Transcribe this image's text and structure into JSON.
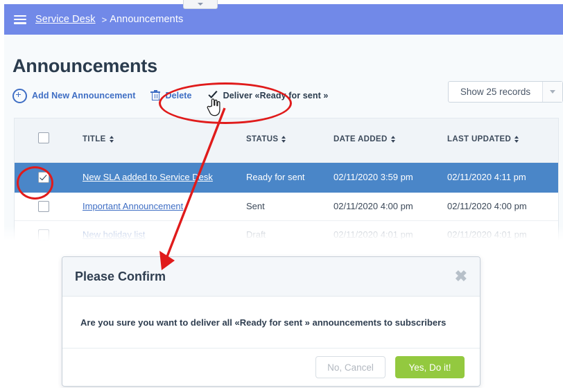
{
  "window": {
    "mini_dropdown_icon": "chevron-down-icon"
  },
  "breadcrumb": {
    "menu_icon": "hamburger-menu-icon",
    "root": "Service Desk",
    "separator": ">",
    "current": "Announcements"
  },
  "page": {
    "title": "Announcements"
  },
  "toolbar": {
    "buttons": [
      {
        "label": "Add New Announcement",
        "icon": "plus-circle-icon"
      },
      {
        "label": "Delete",
        "icon": "trash-icon"
      },
      {
        "label": "Deliver «Ready for sent »",
        "icon": "check-icon"
      }
    ]
  },
  "records_select": {
    "value": "Show 25 records",
    "caret_icon": "chevron-down-icon"
  },
  "table": {
    "select_all_checked": false,
    "columns": [
      {
        "key": "check",
        "label": "",
        "sortable": false
      },
      {
        "key": "title",
        "label": "TITLE",
        "sortable": true
      },
      {
        "key": "status",
        "label": "STATUS",
        "sortable": true
      },
      {
        "key": "date_added",
        "label": "DATE ADDED",
        "sortable": true
      },
      {
        "key": "last_updated",
        "label": "LAST UPDATED",
        "sortable": true
      }
    ],
    "rows": [
      {
        "checked": true,
        "selected": true,
        "title": "New SLA added to Service Desk",
        "status": "Ready for sent",
        "date_added": "02/11/2020 3:59 pm",
        "last_updated": "02/11/2020 4:11 pm"
      },
      {
        "checked": false,
        "selected": false,
        "title": "Important Announcement",
        "status": "Sent",
        "date_added": "02/11/2020 4:00 pm",
        "last_updated": "02/11/2020 4:00 pm"
      },
      {
        "checked": false,
        "selected": false,
        "title": "New holiday list",
        "status": "Draft",
        "date_added": "02/11/2020 4:01 pm",
        "last_updated": "02/11/2020 4:01 pm"
      }
    ]
  },
  "modal": {
    "title": "Please Confirm",
    "close_icon": "close-icon",
    "message": "Are you sure you want to deliver all «Ready for sent » announcements to subscribers",
    "cancel_label": "No, Cancel",
    "confirm_label": "Yes, Do it!"
  },
  "annotations": {
    "ellipse_deliver": "highlight-ellipse",
    "ellipse_checkbox": "highlight-ellipse",
    "arrow": "callout-arrow",
    "color": "#e01b1b"
  },
  "cursor": {
    "icon": "pointing-hand-cursor"
  },
  "colors": {
    "breadcrumb_bar": "#7189e8",
    "selected_row": "#4a86c8",
    "link": "#3f6ec4",
    "confirm_green": "#93c93f",
    "page_bg": "#f7fafc",
    "table_head": "#f0f4f8"
  }
}
